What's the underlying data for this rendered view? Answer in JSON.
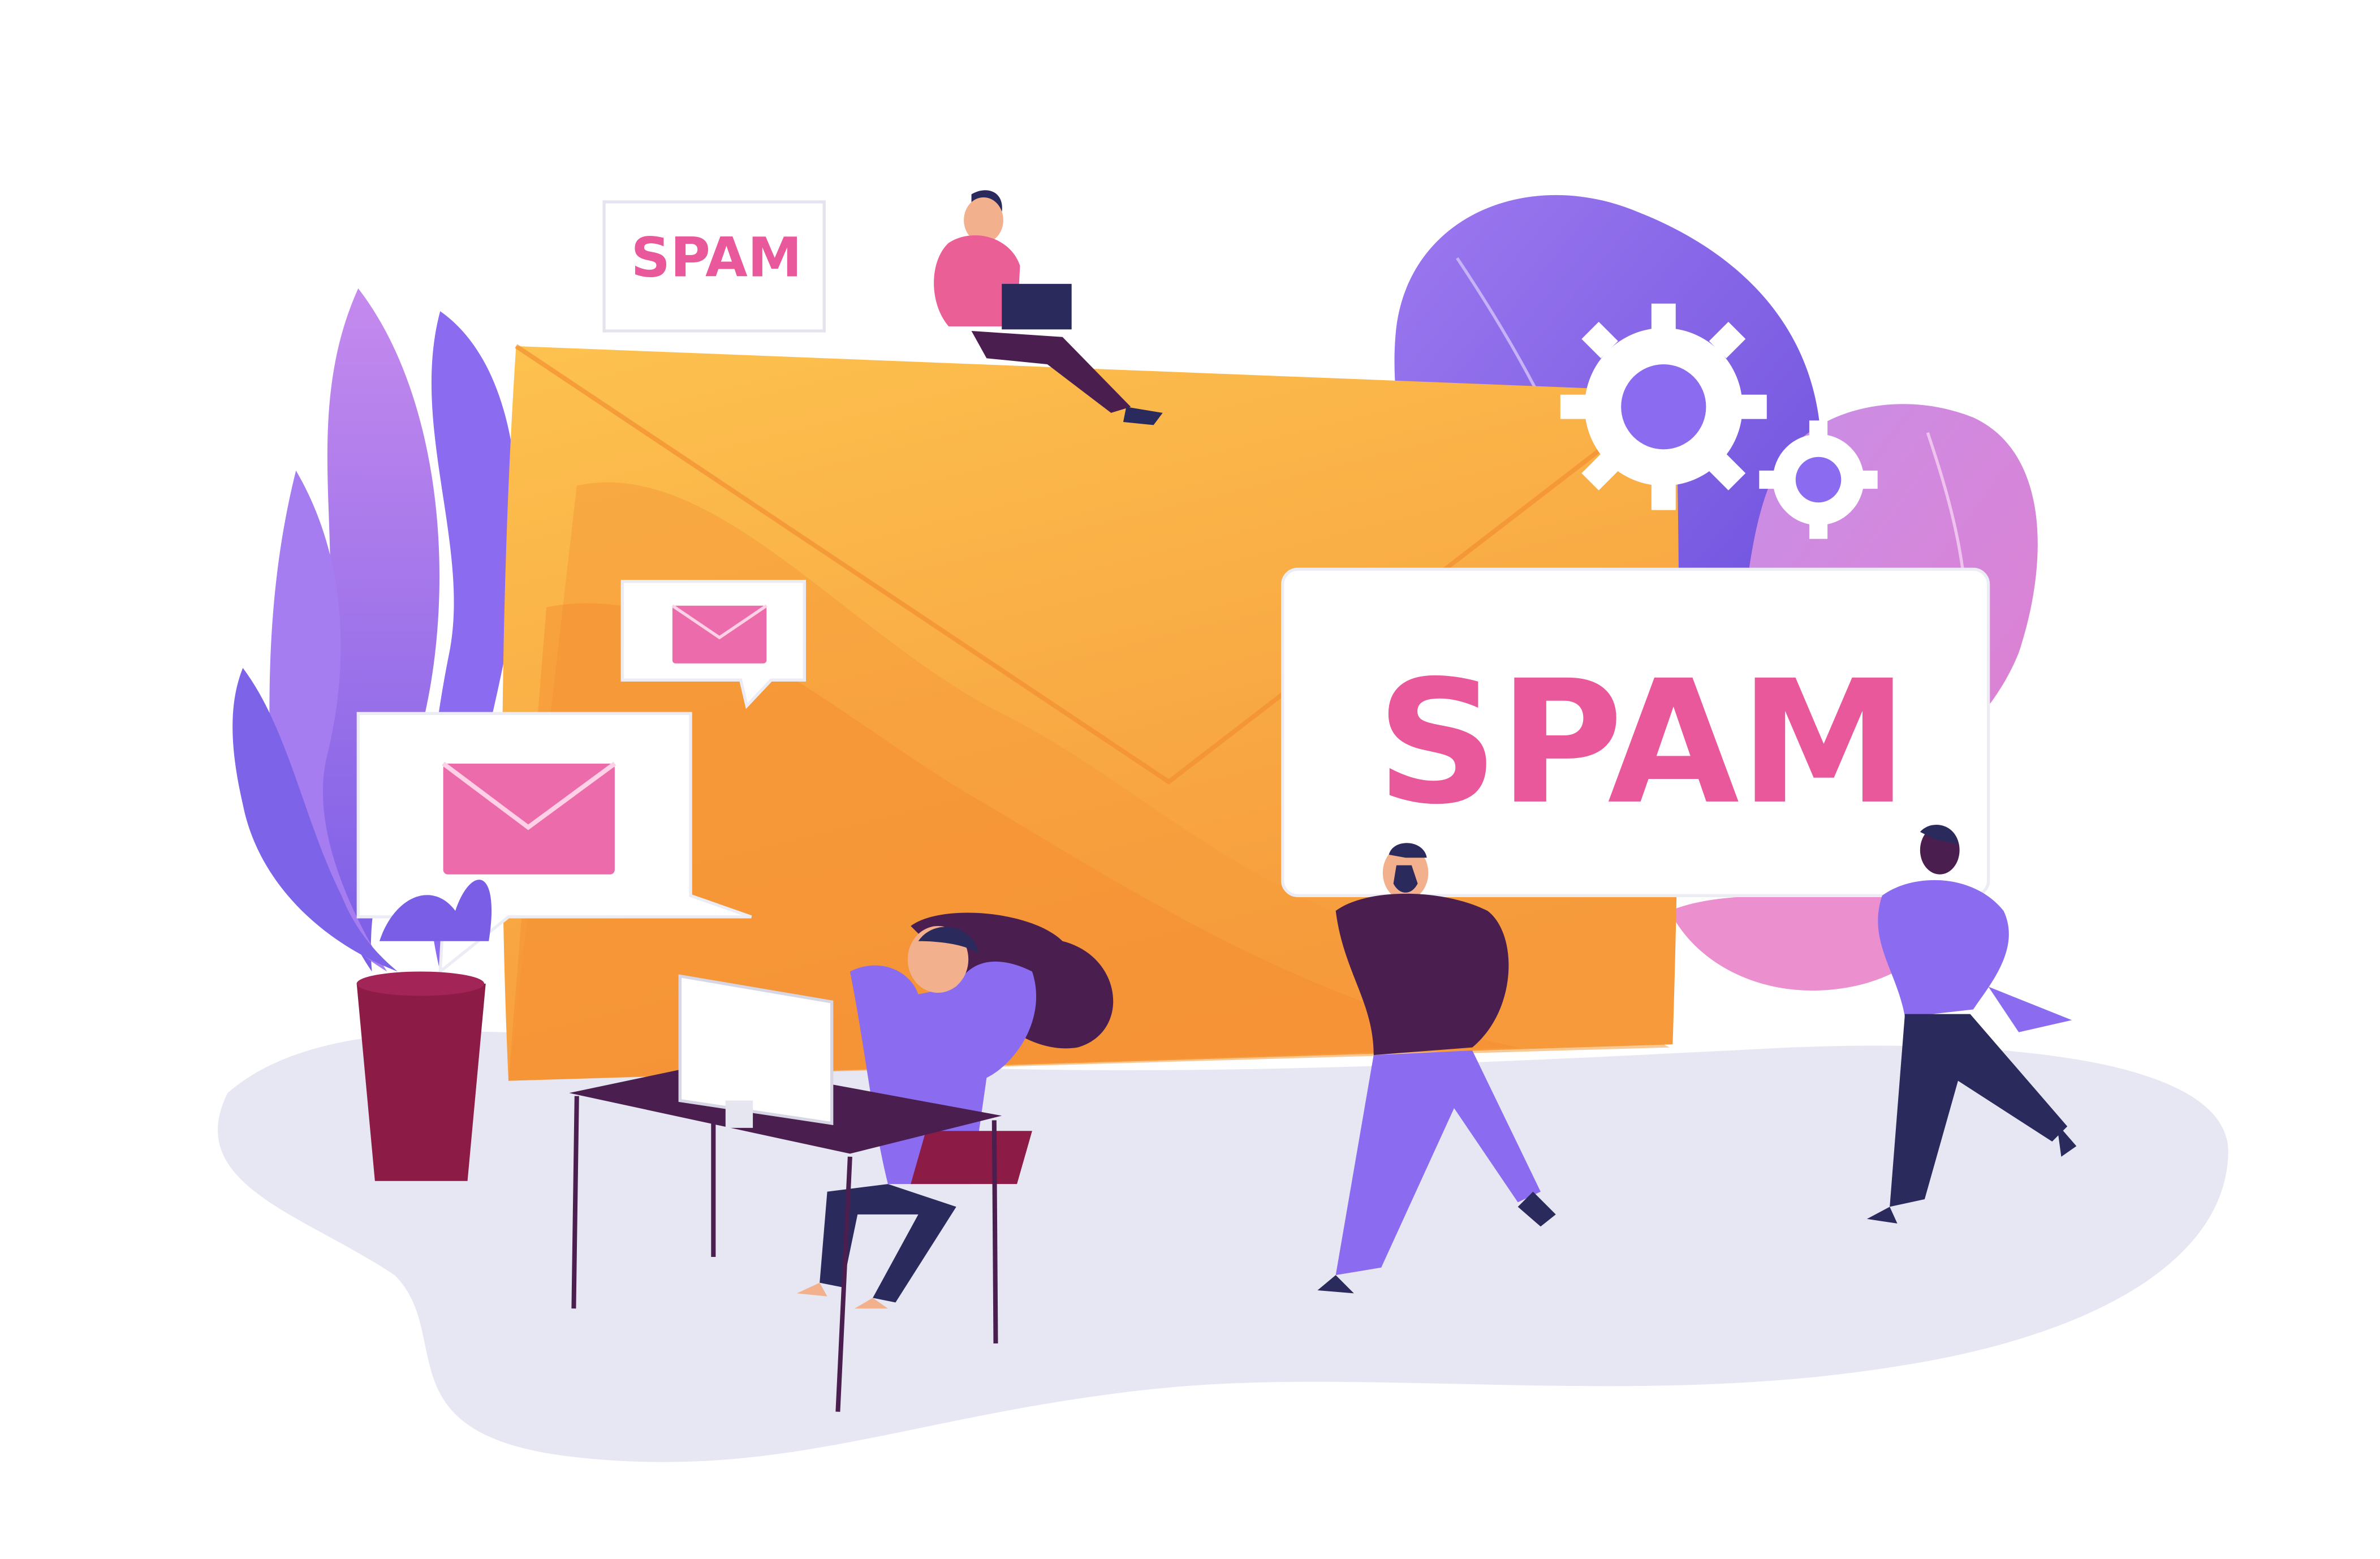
{
  "illustration": {
    "small_sign_text": "SPAM",
    "big_sign_text": "SPAM"
  },
  "colors": {
    "background": "#ffffff",
    "ground": "#e7e8f3",
    "envelope_light": "#fcc14e",
    "envelope_dark": "#f6a03c",
    "purple": "#8b6cf0",
    "violet": "#b888ee",
    "pink_accent": "#e8589a",
    "dark_plum": "#4a1f4f",
    "navy": "#2b2a5c",
    "maroon": "#8c1c46"
  },
  "icons": [
    "envelope-icon",
    "gear-icon"
  ]
}
